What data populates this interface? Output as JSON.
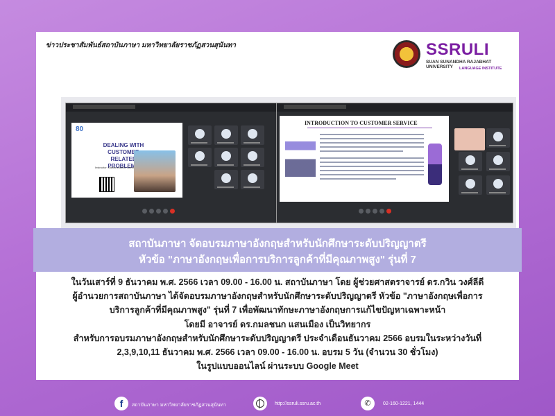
{
  "header": {
    "caption": "ข่าวประชาสัมพันธ์สถาบันภาษา มหาวิทยาลัยราชภัฏสวนสุนันทา"
  },
  "logo": {
    "main": "SSRULI",
    "sub1": "SUAN SUNANDHA RAJABHAT UNIVERSITY",
    "sub2": "LANGUAGE INSTITUTE"
  },
  "screenshot_left": {
    "slide_number": "80",
    "slide_title": "DEALING WITH CUSTOMER RELATED PROBLEMS",
    "instructor": "Instructor: Kamonchanok Saenmueang"
  },
  "screenshot_right": {
    "slide_title": "INTRODUCTION TO CUSTOMER SERVICE"
  },
  "banner": {
    "line1": "สถาบันภาษา จัดอบรมภาษาอังกฤษสำหรับนักศึกษาระดับปริญญาตรี",
    "line2": "หัวข้อ \"ภาษาอังกฤษเพื่อการบริการลูกค้าที่มีคุณภาพสูง\" รุ่นที่ 7"
  },
  "body": {
    "lines": [
      "ในวันเสาร์ที่ 9 ธันวาคม พ.ศ. 2566 เวลา 09.00 - 16.00 น. สถาบันภาษา โดย ผู้ช่วยศาสตราจารย์ ดร.กวิน วงศ์ลีดี",
      "ผู้อำนวยการสถาบันภาษา ได้จัดอบรมภาษาอังกฤษสำหรับนักศึกษาระดับปริญญาตรี หัวข้อ \"ภาษาอังกฤษเพื่อการ",
      "บริการลูกค้าที่มีคุณภาพสูง\" รุ่นที่ 7 เพื่อพัฒนาทักษะภาษาอังกฤษการแก้ไขปัญหาเฉพาะหน้า",
      "โดยมี อาจารย์ ดร.กมลชนก แสนเมือง เป็นวิทยากร",
      "สำหรับการอบรมภาษาอังกฤษสำหรับนักศึกษาระดับปริญญาตรี ประจำเดือนธันวาคม 2566 อบรมในระหว่างวันที่",
      "2,3,9,10,11 ธันวาคม พ.ศ. 2566 เวลา 09.00 - 16.00 น. อบรม 5 วัน (จำนวน 30 ชั่วโมง)",
      "ในรูปแบบออนไลน์ ผ่านระบบ Google Meet"
    ]
  },
  "footer": {
    "facebook": "สถาบันภาษา มหาวิทยาลัยราชภัฏสวนสุนันทา",
    "website": "http://ssruli.ssru.ac.th",
    "phone": "02-160-1221, 1444"
  },
  "colors": {
    "background": "#b76fd6",
    "banner": "#b2aee0",
    "logo": "#7b1fa2"
  }
}
